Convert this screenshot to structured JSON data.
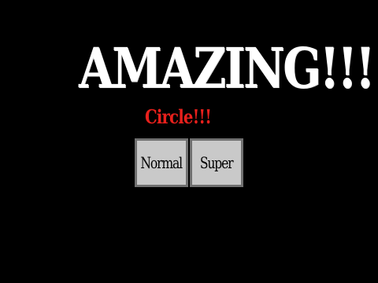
{
  "title": "AMAZING!!!",
  "subtitle": "Circle!!!",
  "buttons": {
    "normal_label": "Normal",
    "super_label": "Super"
  },
  "colors": {
    "background": "#000000",
    "title": "#ffffff",
    "subtitle": "#e8201c",
    "button_face": "#c9c9c9",
    "button_border": "#707070"
  }
}
